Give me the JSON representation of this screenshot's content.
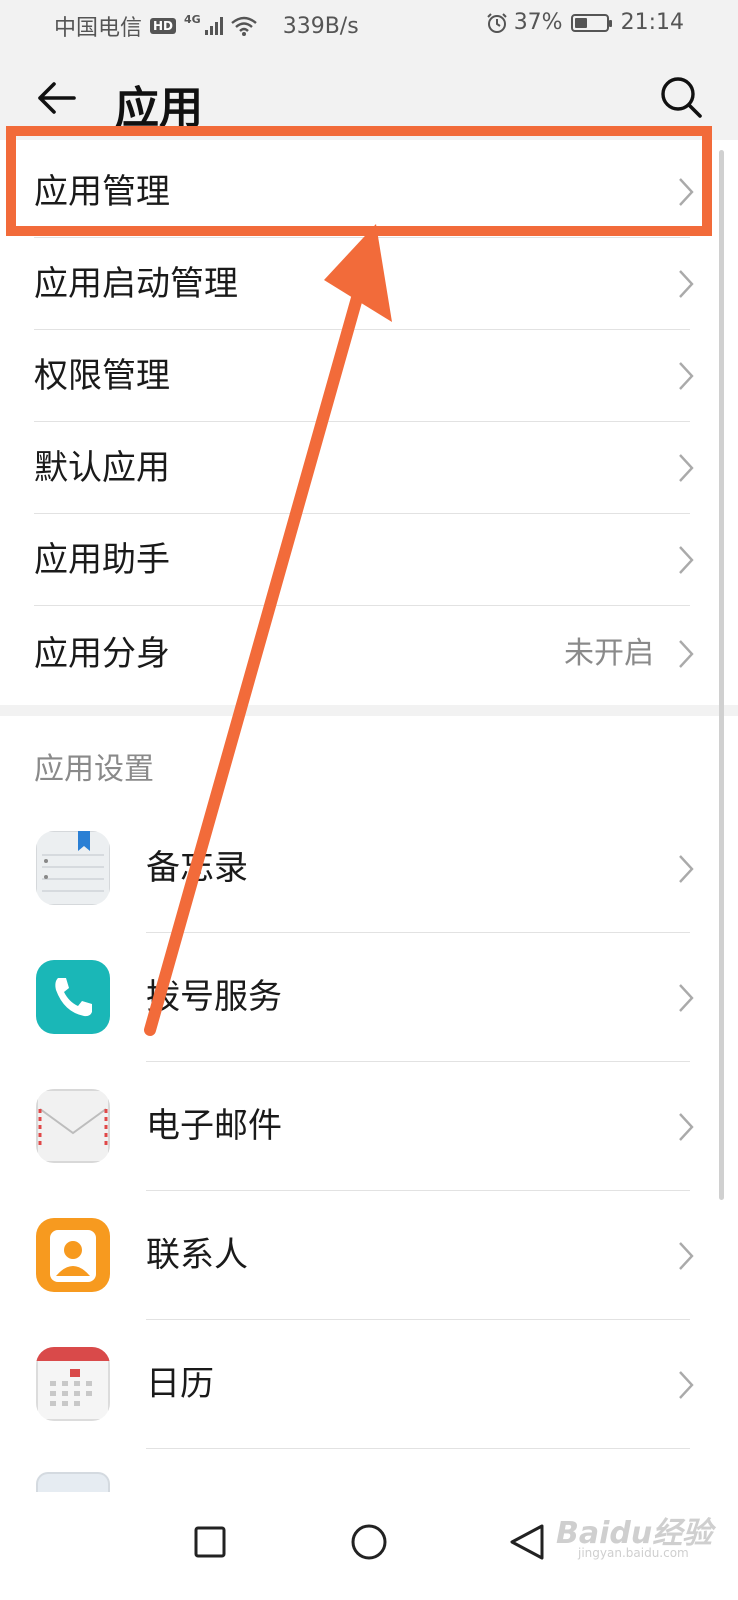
{
  "status_bar": {
    "carrier": "中国电信",
    "hd_badge": "HD",
    "network_type": "4G",
    "speed": "339B/s",
    "battery": "37%",
    "time": "21:14"
  },
  "header": {
    "title": "应用"
  },
  "menu": [
    {
      "label": "应用管理",
      "value": ""
    },
    {
      "label": "应用启动管理",
      "value": ""
    },
    {
      "label": "权限管理",
      "value": ""
    },
    {
      "label": "默认应用",
      "value": ""
    },
    {
      "label": "应用助手",
      "value": ""
    },
    {
      "label": "应用分身",
      "value": "未开启"
    }
  ],
  "app_settings": {
    "section_title": "应用设置",
    "apps": [
      {
        "label": "备忘录",
        "icon": "notepad-icon"
      },
      {
        "label": "拨号服务",
        "icon": "phone-icon"
      },
      {
        "label": "电子邮件",
        "icon": "email-icon"
      },
      {
        "label": "联系人",
        "icon": "contacts-icon"
      },
      {
        "label": "日历",
        "icon": "calendar-icon"
      }
    ]
  },
  "annotation": {
    "color": "#f26b3a"
  },
  "watermark": {
    "text": "Baidu经验",
    "sub": "jingyan.baidu.com"
  }
}
